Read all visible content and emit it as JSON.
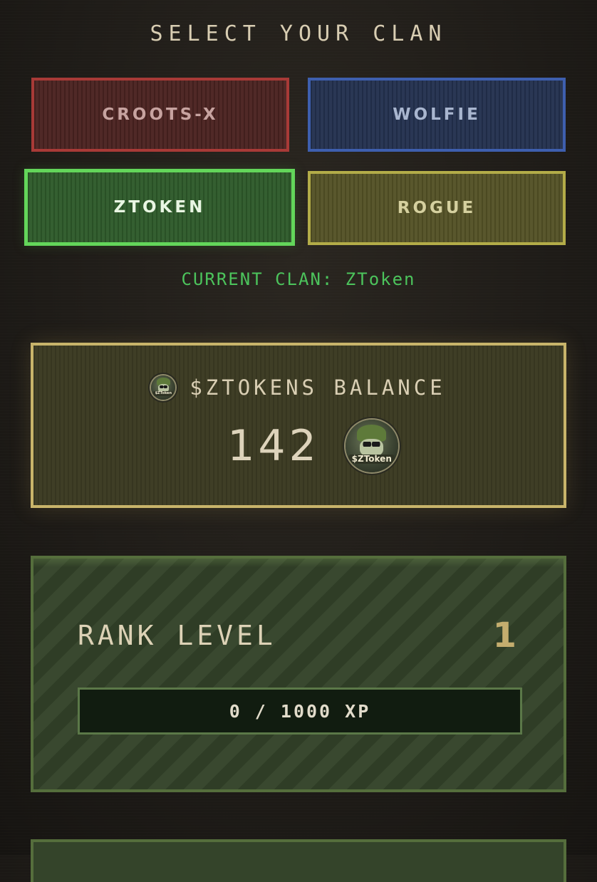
{
  "header": {
    "title": "SELECT YOUR CLAN"
  },
  "clans": [
    {
      "label": "CROOTS-X",
      "color": "#a83a37",
      "selected": false
    },
    {
      "label": "WOLFIE",
      "color": "#3e5fae",
      "selected": false
    },
    {
      "label": "ZTOKEN",
      "color": "#63d65a",
      "selected": true
    },
    {
      "label": "ROGUE",
      "color": "#b3ac48",
      "selected": false
    }
  ],
  "current_clan": {
    "text": "CURRENT CLAN: ZToken"
  },
  "balance": {
    "title": "$ZTOKENS BALANCE",
    "value": "142",
    "icon": "ztoken-coin-icon",
    "coin_label": "$ZToken"
  },
  "rank": {
    "label": "RANK LEVEL",
    "level": "1",
    "xp_text": "0 / 1000 XP",
    "xp_current": 0,
    "xp_max": 1000
  },
  "colors": {
    "accent_green": "#4cc45c",
    "gold": "#c8b46a",
    "rank_green": "#556e3c"
  }
}
